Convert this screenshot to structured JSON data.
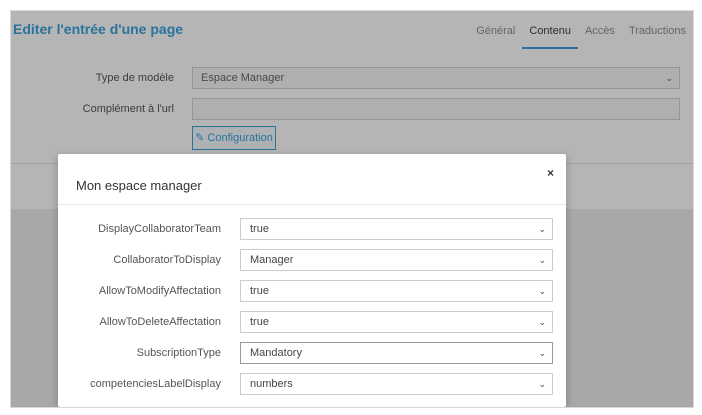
{
  "page": {
    "title": "Editer l'entrée d'une page",
    "tabs": [
      {
        "label": "Général",
        "active": false
      },
      {
        "label": "Contenu",
        "active": true
      },
      {
        "label": "Accès",
        "active": false
      },
      {
        "label": "Traductions",
        "active": false
      }
    ],
    "form": {
      "model_type_label": "Type de modèle",
      "model_type_value": "Espace Manager",
      "url_complement_label": "Complément à l'url",
      "url_complement_value": "",
      "configuration_button": "Configuration"
    }
  },
  "modal": {
    "title": "Mon espace manager",
    "close_symbol": "×",
    "fields": [
      {
        "label": "DisplayCollaboratorTeam",
        "value": "true"
      },
      {
        "label": "CollaboratorToDisplay",
        "value": "Manager"
      },
      {
        "label": "AllowToModifyAffectation",
        "value": "true"
      },
      {
        "label": "AllowToDeleteAffectation",
        "value": "true"
      },
      {
        "label": "SubscriptionType",
        "value": "Mandatory"
      },
      {
        "label": "competenciesLabelDisplay",
        "value": "numbers"
      }
    ]
  },
  "icons": {
    "select_chevron": "chevron-down-icon",
    "configuration": "pencil-icon"
  },
  "colors": {
    "accent": "#39a0d8"
  }
}
